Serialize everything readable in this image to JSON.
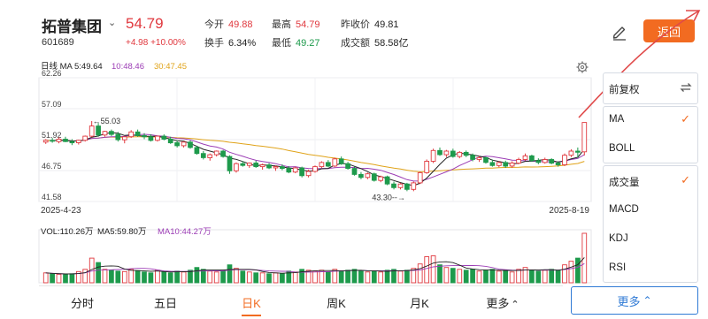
{
  "stock": {
    "name": "拓普集团",
    "code": "601689",
    "dropdown": "⌄",
    "price": "54.79",
    "change": "+4.98 +10.00%"
  },
  "quotes": {
    "open_label": "今开",
    "open": "49.88",
    "high_label": "最高",
    "high": "54.79",
    "prev_label": "昨收价",
    "prev": "49.81",
    "turnover_label": "换手",
    "turnover": "6.34%",
    "low_label": "最低",
    "low": "49.27",
    "amount_label": "成交额",
    "amount": "58.58亿"
  },
  "actions": {
    "back_label": "返回",
    "more_label": "更多",
    "more_caret": "⌃"
  },
  "chart_data": {
    "type": "candlestick",
    "price_legend": {
      "period": "日线",
      "ma": "MA",
      "ma5": "5:49.64",
      "ma10": "10:48.46",
      "ma30": "30:47.45"
    },
    "y_ticks": [
      "62.26",
      "57.09",
      "51.92",
      "46.75",
      "41.58"
    ],
    "y_range": [
      41.58,
      62.26
    ],
    "start_date": "2025-4-23",
    "end_date": "2025-8-19",
    "annotations": {
      "high": "←55.03",
      "low": "43.30--→"
    },
    "volume_legend": {
      "vol": "VOL:110.26万",
      "ma5": "MA5:59.80万",
      "ma10": "MA10:44.27万"
    },
    "colors": {
      "up": "#e0383e",
      "down": "#1e9a4c",
      "ma5": "#222222",
      "ma10": "#9c3db5",
      "ma30": "#e0a319"
    },
    "candles": [
      [
        51.5,
        52.0,
        51.2,
        51.8
      ],
      [
        51.8,
        52.2,
        51.4,
        51.7
      ],
      [
        51.6,
        52.3,
        51.3,
        52.0
      ],
      [
        52.0,
        52.4,
        51.5,
        51.6
      ],
      [
        51.6,
        52.0,
        51.0,
        51.4
      ],
      [
        51.4,
        51.9,
        51.1,
        51.8
      ],
      [
        51.8,
        52.6,
        51.6,
        52.5
      ],
      [
        52.5,
        55.03,
        52.3,
        54.2
      ],
      [
        54.2,
        54.7,
        52.4,
        52.7
      ],
      [
        52.7,
        53.4,
        52.4,
        53.3
      ],
      [
        53.3,
        53.6,
        52.5,
        52.8
      ],
      [
        52.8,
        53.2,
        51.6,
        51.9
      ],
      [
        51.9,
        52.5,
        51.3,
        52.4
      ],
      [
        52.4,
        53.5,
        52.2,
        53.2
      ],
      [
        53.2,
        53.6,
        52.4,
        52.6
      ],
      [
        52.6,
        53.0,
        52.0,
        52.4
      ],
      [
        52.4,
        52.8,
        51.6,
        51.8
      ],
      [
        51.8,
        52.6,
        51.6,
        52.5
      ],
      [
        52.5,
        52.8,
        51.8,
        52.0
      ],
      [
        52.0,
        52.4,
        51.2,
        51.4
      ],
      [
        51.4,
        51.8,
        50.6,
        50.9
      ],
      [
        50.9,
        51.6,
        50.6,
        51.5
      ],
      [
        51.5,
        51.8,
        50.4,
        50.6
      ],
      [
        50.6,
        50.9,
        49.4,
        49.6
      ],
      [
        49.6,
        50.0,
        48.6,
        48.9
      ],
      [
        48.9,
        49.6,
        48.4,
        49.4
      ],
      [
        49.4,
        50.1,
        49.1,
        50.0
      ],
      [
        50.0,
        50.2,
        48.9,
        49.1
      ],
      [
        49.1,
        49.3,
        46.2,
        46.7
      ],
      [
        46.7,
        48.1,
        46.4,
        47.9
      ],
      [
        47.9,
        48.3,
        47.4,
        47.6
      ],
      [
        47.6,
        48.1,
        47.2,
        48.0
      ],
      [
        48.0,
        48.4,
        47.2,
        47.4
      ],
      [
        47.4,
        47.9,
        46.9,
        47.7
      ],
      [
        47.7,
        48.0,
        47.0,
        47.2
      ],
      [
        47.2,
        47.6,
        46.7,
        47.4
      ],
      [
        47.4,
        47.8,
        46.8,
        47.1
      ],
      [
        47.1,
        47.5,
        46.3,
        46.5
      ],
      [
        46.5,
        47.4,
        46.3,
        47.2
      ],
      [
        47.2,
        47.4,
        45.6,
        45.9
      ],
      [
        45.9,
        46.9,
        45.6,
        46.6
      ],
      [
        46.6,
        47.6,
        46.4,
        47.4
      ],
      [
        47.4,
        48.3,
        47.2,
        48.1
      ],
      [
        48.1,
        48.5,
        47.3,
        47.5
      ],
      [
        47.5,
        48.9,
        47.3,
        48.7
      ],
      [
        48.7,
        49.1,
        47.7,
        47.9
      ],
      [
        47.9,
        48.2,
        46.9,
        47.1
      ],
      [
        47.1,
        47.4,
        45.9,
        46.1
      ],
      [
        46.1,
        46.5,
        45.3,
        45.6
      ],
      [
        45.6,
        46.4,
        45.3,
        46.2
      ],
      [
        46.2,
        46.4,
        44.9,
        45.1
      ],
      [
        45.1,
        45.9,
        44.8,
        45.7
      ],
      [
        45.7,
        45.9,
        44.3,
        44.5
      ],
      [
        44.5,
        44.9,
        43.6,
        43.9
      ],
      [
        43.9,
        44.7,
        43.6,
        44.5
      ],
      [
        44.5,
        44.7,
        43.3,
        43.6
      ],
      [
        43.6,
        44.9,
        43.3,
        44.7
      ],
      [
        44.7,
        46.6,
        44.5,
        46.4
      ],
      [
        46.4,
        48.6,
        46.2,
        48.3
      ],
      [
        48.3,
        50.4,
        48.0,
        50.1
      ],
      [
        50.1,
        50.6,
        49.2,
        49.4
      ],
      [
        49.4,
        50.2,
        49.0,
        50.0
      ],
      [
        50.0,
        50.4,
        48.9,
        49.1
      ],
      [
        49.1,
        50.0,
        48.8,
        49.8
      ],
      [
        49.8,
        50.1,
        49.0,
        49.3
      ],
      [
        49.3,
        49.6,
        48.3,
        48.6
      ],
      [
        48.6,
        49.2,
        48.2,
        48.9
      ],
      [
        48.9,
        49.1,
        47.9,
        48.1
      ],
      [
        48.1,
        48.6,
        47.4,
        47.6
      ],
      [
        47.6,
        48.3,
        47.3,
        48.1
      ],
      [
        48.1,
        48.4,
        47.2,
        47.5
      ],
      [
        47.5,
        48.3,
        47.2,
        48.0
      ],
      [
        48.0,
        48.9,
        47.8,
        48.6
      ],
      [
        48.6,
        49.6,
        48.4,
        49.2
      ],
      [
        49.2,
        49.4,
        48.2,
        48.4
      ],
      [
        48.4,
        48.8,
        47.8,
        48.1
      ],
      [
        48.1,
        48.9,
        47.9,
        48.6
      ],
      [
        48.6,
        48.8,
        47.8,
        48.0
      ],
      [
        48.0,
        48.3,
        47.4,
        47.7
      ],
      [
        47.7,
        49.6,
        47.5,
        49.3
      ],
      [
        49.3,
        50.3,
        49.0,
        50.0
      ],
      [
        50.0,
        50.6,
        48.9,
        49.81
      ],
      [
        49.88,
        54.79,
        49.27,
        54.79
      ]
    ],
    "volumes": [
      22,
      20,
      19,
      18,
      20,
      25,
      30,
      55,
      45,
      30,
      28,
      26,
      25,
      30,
      27,
      24,
      22,
      28,
      24,
      22,
      26,
      24,
      28,
      34,
      30,
      26,
      24,
      28,
      40,
      32,
      26,
      24,
      22,
      22,
      20,
      22,
      20,
      26,
      24,
      30,
      28,
      26,
      28,
      24,
      30,
      26,
      28,
      30,
      26,
      24,
      26,
      24,
      28,
      30,
      26,
      28,
      32,
      42,
      58,
      60,
      40,
      34,
      32,
      30,
      28,
      30,
      26,
      28,
      30,
      26,
      28,
      24,
      30,
      34,
      28,
      26,
      28,
      30,
      28,
      40,
      48,
      55,
      110.26
    ]
  },
  "side_panel": {
    "adjust_label": "前复权",
    "indicators": [
      {
        "label": "MA",
        "checked": true
      },
      {
        "label": "BOLL",
        "checked": false
      }
    ],
    "sub_indicators": [
      {
        "label": "成交量",
        "checked": true
      },
      {
        "label": "MACD",
        "checked": false
      },
      {
        "label": "KDJ",
        "checked": false
      },
      {
        "label": "RSI",
        "checked": false
      }
    ],
    "checkmark": "✓"
  },
  "tabs": [
    {
      "label": "分时",
      "active": false
    },
    {
      "label": "五日",
      "active": false
    },
    {
      "label": "日K",
      "active": true
    },
    {
      "label": "周K",
      "active": false
    },
    {
      "label": "月K",
      "active": false
    },
    {
      "label": "更多",
      "caret": "⌃",
      "active": false
    }
  ]
}
